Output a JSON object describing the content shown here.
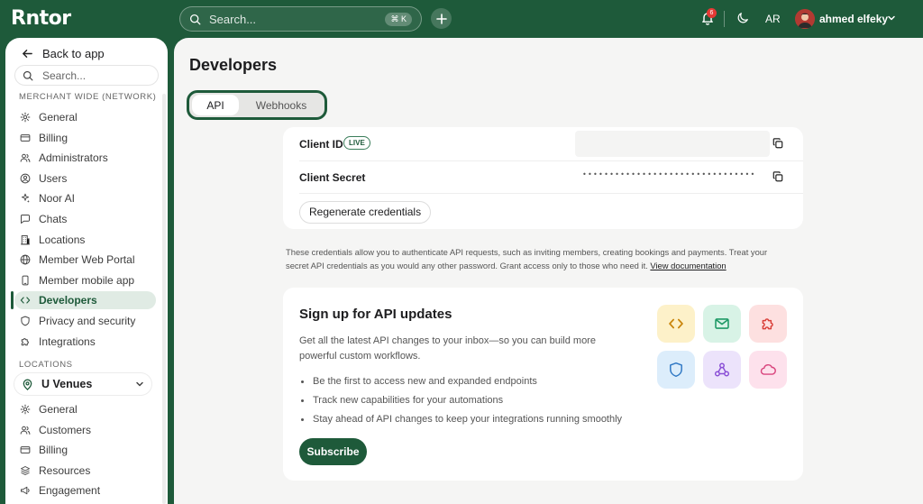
{
  "topbar": {
    "logo": "Rntor",
    "search_placeholder": "Search...",
    "search_shortcut": "⌘ K",
    "notification_count": "6",
    "language": "AR",
    "user_name": "ahmed elfeky"
  },
  "sidebar": {
    "back_label": "Back to app",
    "search_placeholder": "Search...",
    "section_network": "MERCHANT WIDE (NETWORK)",
    "network_items": [
      {
        "label": "General",
        "icon": "gear-icon"
      },
      {
        "label": "Billing",
        "icon": "card-icon"
      },
      {
        "label": "Administrators",
        "icon": "users-icon"
      },
      {
        "label": "Users",
        "icon": "user-circle-icon"
      },
      {
        "label": "Noor AI",
        "icon": "sparkle-icon"
      },
      {
        "label": "Chats",
        "icon": "chat-icon"
      },
      {
        "label": "Locations",
        "icon": "building-icon"
      },
      {
        "label": "Member Web Portal",
        "icon": "globe-icon"
      },
      {
        "label": "Member mobile app",
        "icon": "phone-icon"
      },
      {
        "label": "Developers",
        "icon": "code-icon",
        "active": true
      },
      {
        "label": "Privacy and security",
        "icon": "shield-icon"
      },
      {
        "label": "Integrations",
        "icon": "puzzle-icon"
      }
    ],
    "section_locations": "LOCATIONS",
    "venue": "U Venues",
    "location_items": [
      {
        "label": "General",
        "icon": "gear-icon"
      },
      {
        "label": "Customers",
        "icon": "users-icon"
      },
      {
        "label": "Billing",
        "icon": "card-icon"
      },
      {
        "label": "Resources",
        "icon": "stack-icon"
      },
      {
        "label": "Engagement",
        "icon": "megaphone-icon"
      }
    ]
  },
  "main": {
    "title": "Developers",
    "tabs": [
      {
        "label": "API",
        "active": true
      },
      {
        "label": "Webhooks",
        "active": false
      }
    ],
    "credentials": {
      "client_id_label": "Client ID",
      "live_badge": "LIVE",
      "client_secret_label": "Client Secret",
      "secret_mask": "••••••••••••••••••••••••••••••••",
      "regenerate_label": "Regenerate credentials"
    },
    "note_text": "These credentials allow you to authenticate API requests, such as inviting members, creating bookings and payments. Treat your secret API credentials as you would any other password. Grant access only to those who need it.",
    "note_link": "View documentation",
    "api_updates": {
      "title": "Sign up for API updates",
      "description": "Get all the latest API changes to your inbox—so you can build more powerful custom workflows.",
      "bullets": [
        "Be the first to access new and expanded endpoints",
        "Track new capabilities for your automations",
        "Stay ahead of API changes to keep your integrations running smoothly"
      ],
      "subscribe_label": "Subscribe",
      "tiles": [
        {
          "icon": "code-icon",
          "bg": "#fdf1c9",
          "fg": "#c9850c"
        },
        {
          "icon": "mail-icon",
          "bg": "#d8f3e6",
          "fg": "#1f9a66"
        },
        {
          "icon": "puzzle-icon",
          "bg": "#fde0e0",
          "fg": "#d9403a"
        },
        {
          "icon": "shield-icon",
          "bg": "#dcedfb",
          "fg": "#2f78c4"
        },
        {
          "icon": "webhook-icon",
          "bg": "#ece3fb",
          "fg": "#8a4fd6"
        },
        {
          "icon": "cloud-icon",
          "bg": "#fde1ec",
          "fg": "#d9467e"
        }
      ]
    }
  },
  "colors": {
    "brand": "#1e5a3a",
    "active_nav_bg": "#e0ebe4",
    "background": "#f5f5f4"
  }
}
